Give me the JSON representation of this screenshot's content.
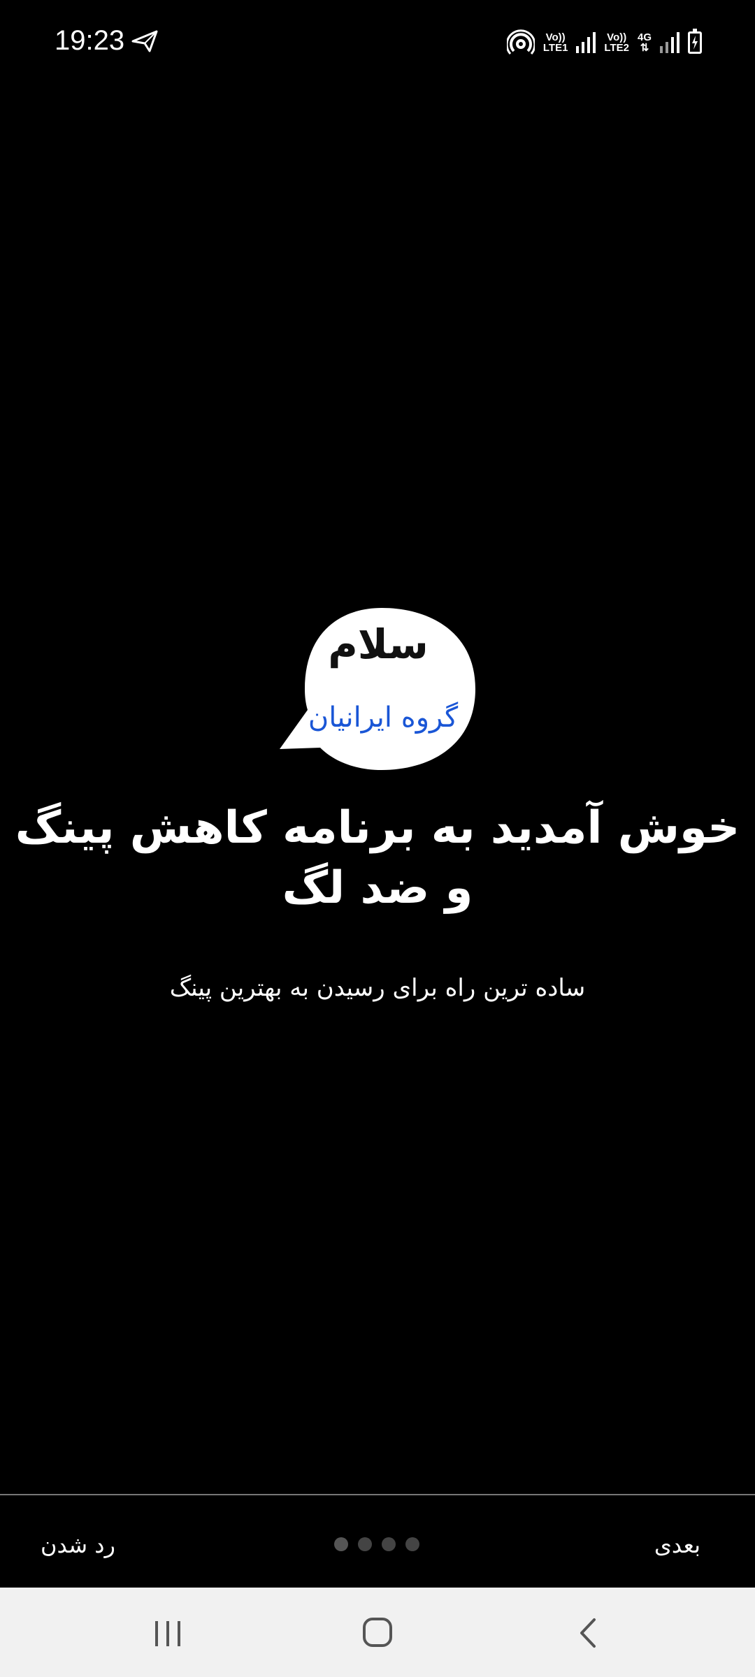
{
  "status_bar": {
    "time": "19:23",
    "sim1_top": "Vo))",
    "sim1_bottom": "LTE1",
    "sim2_top": "Vo))",
    "sim2_bottom": "LTE2",
    "network": "4G",
    "icons": [
      "send-icon",
      "hotspot-icon",
      "signal-icon",
      "battery-charging-icon"
    ]
  },
  "logo": {
    "text_top": "سلام",
    "text_bottom": "گروه ایرانیان",
    "bubble_color": "#ffffff",
    "text_bottom_color": "#1a56d6"
  },
  "welcome": {
    "title": "خوش آمدید به برنامه کاهش پینگ و ضد لگ",
    "subtitle": "ساده ترین راه برای رسیدن به بهترین پینگ"
  },
  "bottom": {
    "skip_label": "رد شدن",
    "next_label": "بعدی",
    "page_count": 4,
    "active_page": 1
  },
  "nav_bar": {
    "icons": [
      "recents-icon",
      "home-icon",
      "back-icon"
    ]
  }
}
